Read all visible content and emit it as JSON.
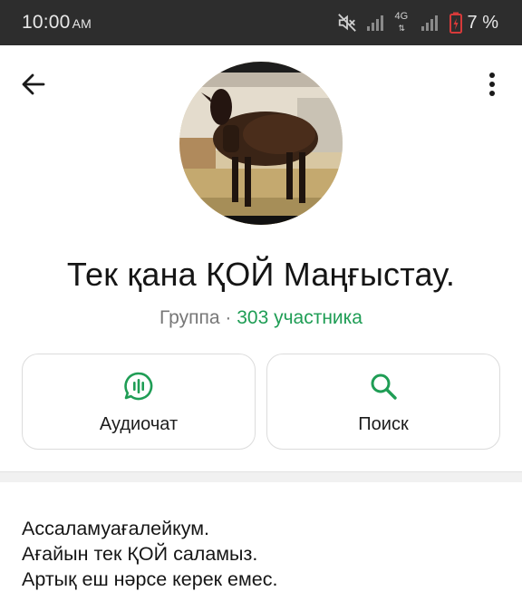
{
  "status_bar": {
    "time": "10:00",
    "ampm": "AM",
    "network": "4G",
    "battery_percent": "7 %"
  },
  "header": {
    "back_icon": "arrow-left-icon",
    "menu_icon": "more-vert-icon"
  },
  "group": {
    "title": "Тек қана ҚОЙ Маңғыстау.",
    "type_label": "Группа",
    "separator": " · ",
    "members_label": "303 участника"
  },
  "actions": {
    "audio_label": "Аудиочат",
    "search_label": "Поиск"
  },
  "description": {
    "lines": [
      "Ассаламуағалейкум.",
      "Ағайын тек ҚОЙ  саламыз.",
      "Артық еш нәрсе керек емес."
    ]
  },
  "colors": {
    "accent_green": "#1f9d55",
    "status_bar_bg": "#2d2d2d"
  }
}
